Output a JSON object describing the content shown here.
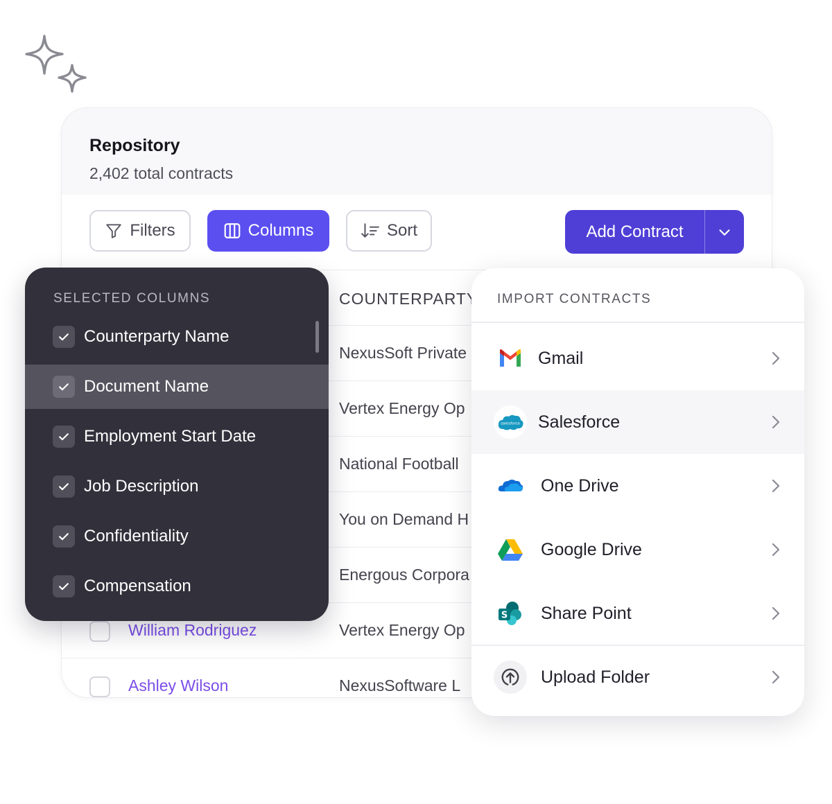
{
  "repository": {
    "title": "Repository",
    "subtitle": "2,402 total contracts"
  },
  "toolbar": {
    "filters_label": "Filters",
    "columns_label": "Columns",
    "sort_label": "Sort",
    "add_contract_label": "Add Contract"
  },
  "table": {
    "counterparty_header": "COUNTERPARTY",
    "rows": [
      {
        "counterparty": "NexusSoft Private"
      },
      {
        "counterparty": "Vertex Energy Op"
      },
      {
        "counterparty": "National Football"
      },
      {
        "counterparty": "You on Demand H"
      },
      {
        "counterparty": "Energous Corpora"
      },
      {
        "name": "William Rodriguez",
        "counterparty": "Vertex Energy Op"
      },
      {
        "name": "Ashley Wilson",
        "counterparty": "NexusSoftware L"
      }
    ]
  },
  "columns_panel": {
    "heading": "SELECTED COLUMNS",
    "items": [
      {
        "label": "Counterparty Name",
        "checked": true
      },
      {
        "label": "Document Name",
        "checked": true
      },
      {
        "label": "Employment Start Date",
        "checked": true
      },
      {
        "label": "Job Description",
        "checked": true
      },
      {
        "label": "Confidentiality",
        "checked": true
      },
      {
        "label": "Compensation",
        "checked": true
      }
    ]
  },
  "import_panel": {
    "heading": "IMPORT CONTRACTS",
    "items": [
      {
        "label": "Gmail",
        "icon": "gmail-icon"
      },
      {
        "label": "Salesforce",
        "icon": "salesforce-icon",
        "icon_text": "salesforce"
      },
      {
        "label": "One Drive",
        "icon": "onedrive-icon"
      },
      {
        "label": "Google Drive",
        "icon": "google-drive-icon"
      },
      {
        "label": "Share Point",
        "icon": "sharepoint-icon",
        "icon_text": "S"
      },
      {
        "label": "Upload Folder",
        "icon": "upload-icon"
      }
    ]
  },
  "colors": {
    "accent": "#5b4ff0",
    "primary_button": "#4f3fd6",
    "link": "#7a4de8",
    "dark_panel": "#32313b"
  }
}
